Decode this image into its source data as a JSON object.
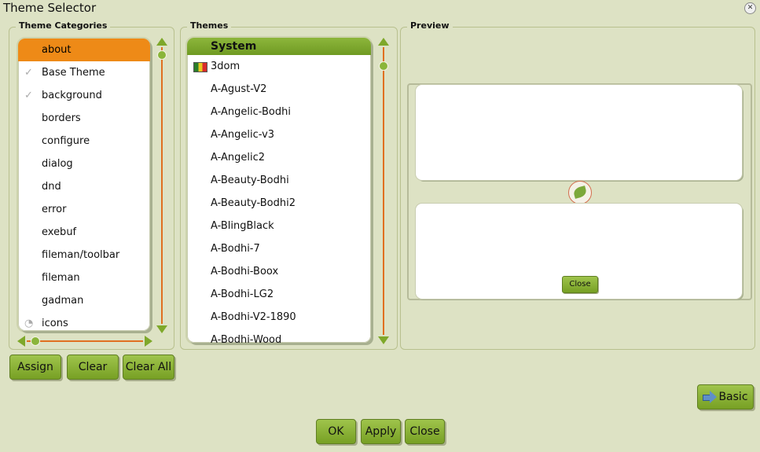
{
  "window": {
    "title": "Theme Selector"
  },
  "categories": {
    "label": "Theme Categories",
    "items": [
      {
        "label": "about",
        "selected": true,
        "mark": ""
      },
      {
        "label": "Base Theme",
        "mark": "check"
      },
      {
        "label": "background",
        "mark": "check"
      },
      {
        "label": "borders",
        "mark": ""
      },
      {
        "label": "configure",
        "mark": ""
      },
      {
        "label": "dialog",
        "mark": ""
      },
      {
        "label": "dnd",
        "mark": ""
      },
      {
        "label": "error",
        "mark": ""
      },
      {
        "label": "exebuf",
        "mark": ""
      },
      {
        "label": "fileman/toolbar",
        "mark": ""
      },
      {
        "label": "fileman",
        "mark": ""
      },
      {
        "label": "gadman",
        "mark": ""
      },
      {
        "label": "icons",
        "mark": "partial"
      }
    ]
  },
  "themes": {
    "label": "Themes",
    "section": "System",
    "items": [
      {
        "label": "3dom",
        "icon": "flag-icon"
      },
      {
        "label": "A-Agust-V2"
      },
      {
        "label": "A-Angelic-Bodhi"
      },
      {
        "label": "A-Angelic-v3"
      },
      {
        "label": "A-Angelic2"
      },
      {
        "label": "A-Beauty-Bodhi"
      },
      {
        "label": "A-Beauty-Bodhi2"
      },
      {
        "label": "A-BlingBlack"
      },
      {
        "label": "A-Bodhi-7"
      },
      {
        "label": "A-Bodhi-Boox"
      },
      {
        "label": "A-Bodhi-LG2"
      },
      {
        "label": "A-Bodhi-V2-1890"
      },
      {
        "label": "A-Bodhi-Wood"
      }
    ]
  },
  "preview": {
    "label": "Preview",
    "close_label": "Close"
  },
  "buttons": {
    "assign": "Assign",
    "clear": "Clear",
    "clear_all": "Clear All",
    "basic": "Basic",
    "ok": "OK",
    "apply": "Apply",
    "close": "Close"
  },
  "colors": {
    "background": "#dde2c4",
    "selection": "#ee8a17",
    "accent_green": "#7ea82a",
    "scroll_track": "#e07020"
  }
}
